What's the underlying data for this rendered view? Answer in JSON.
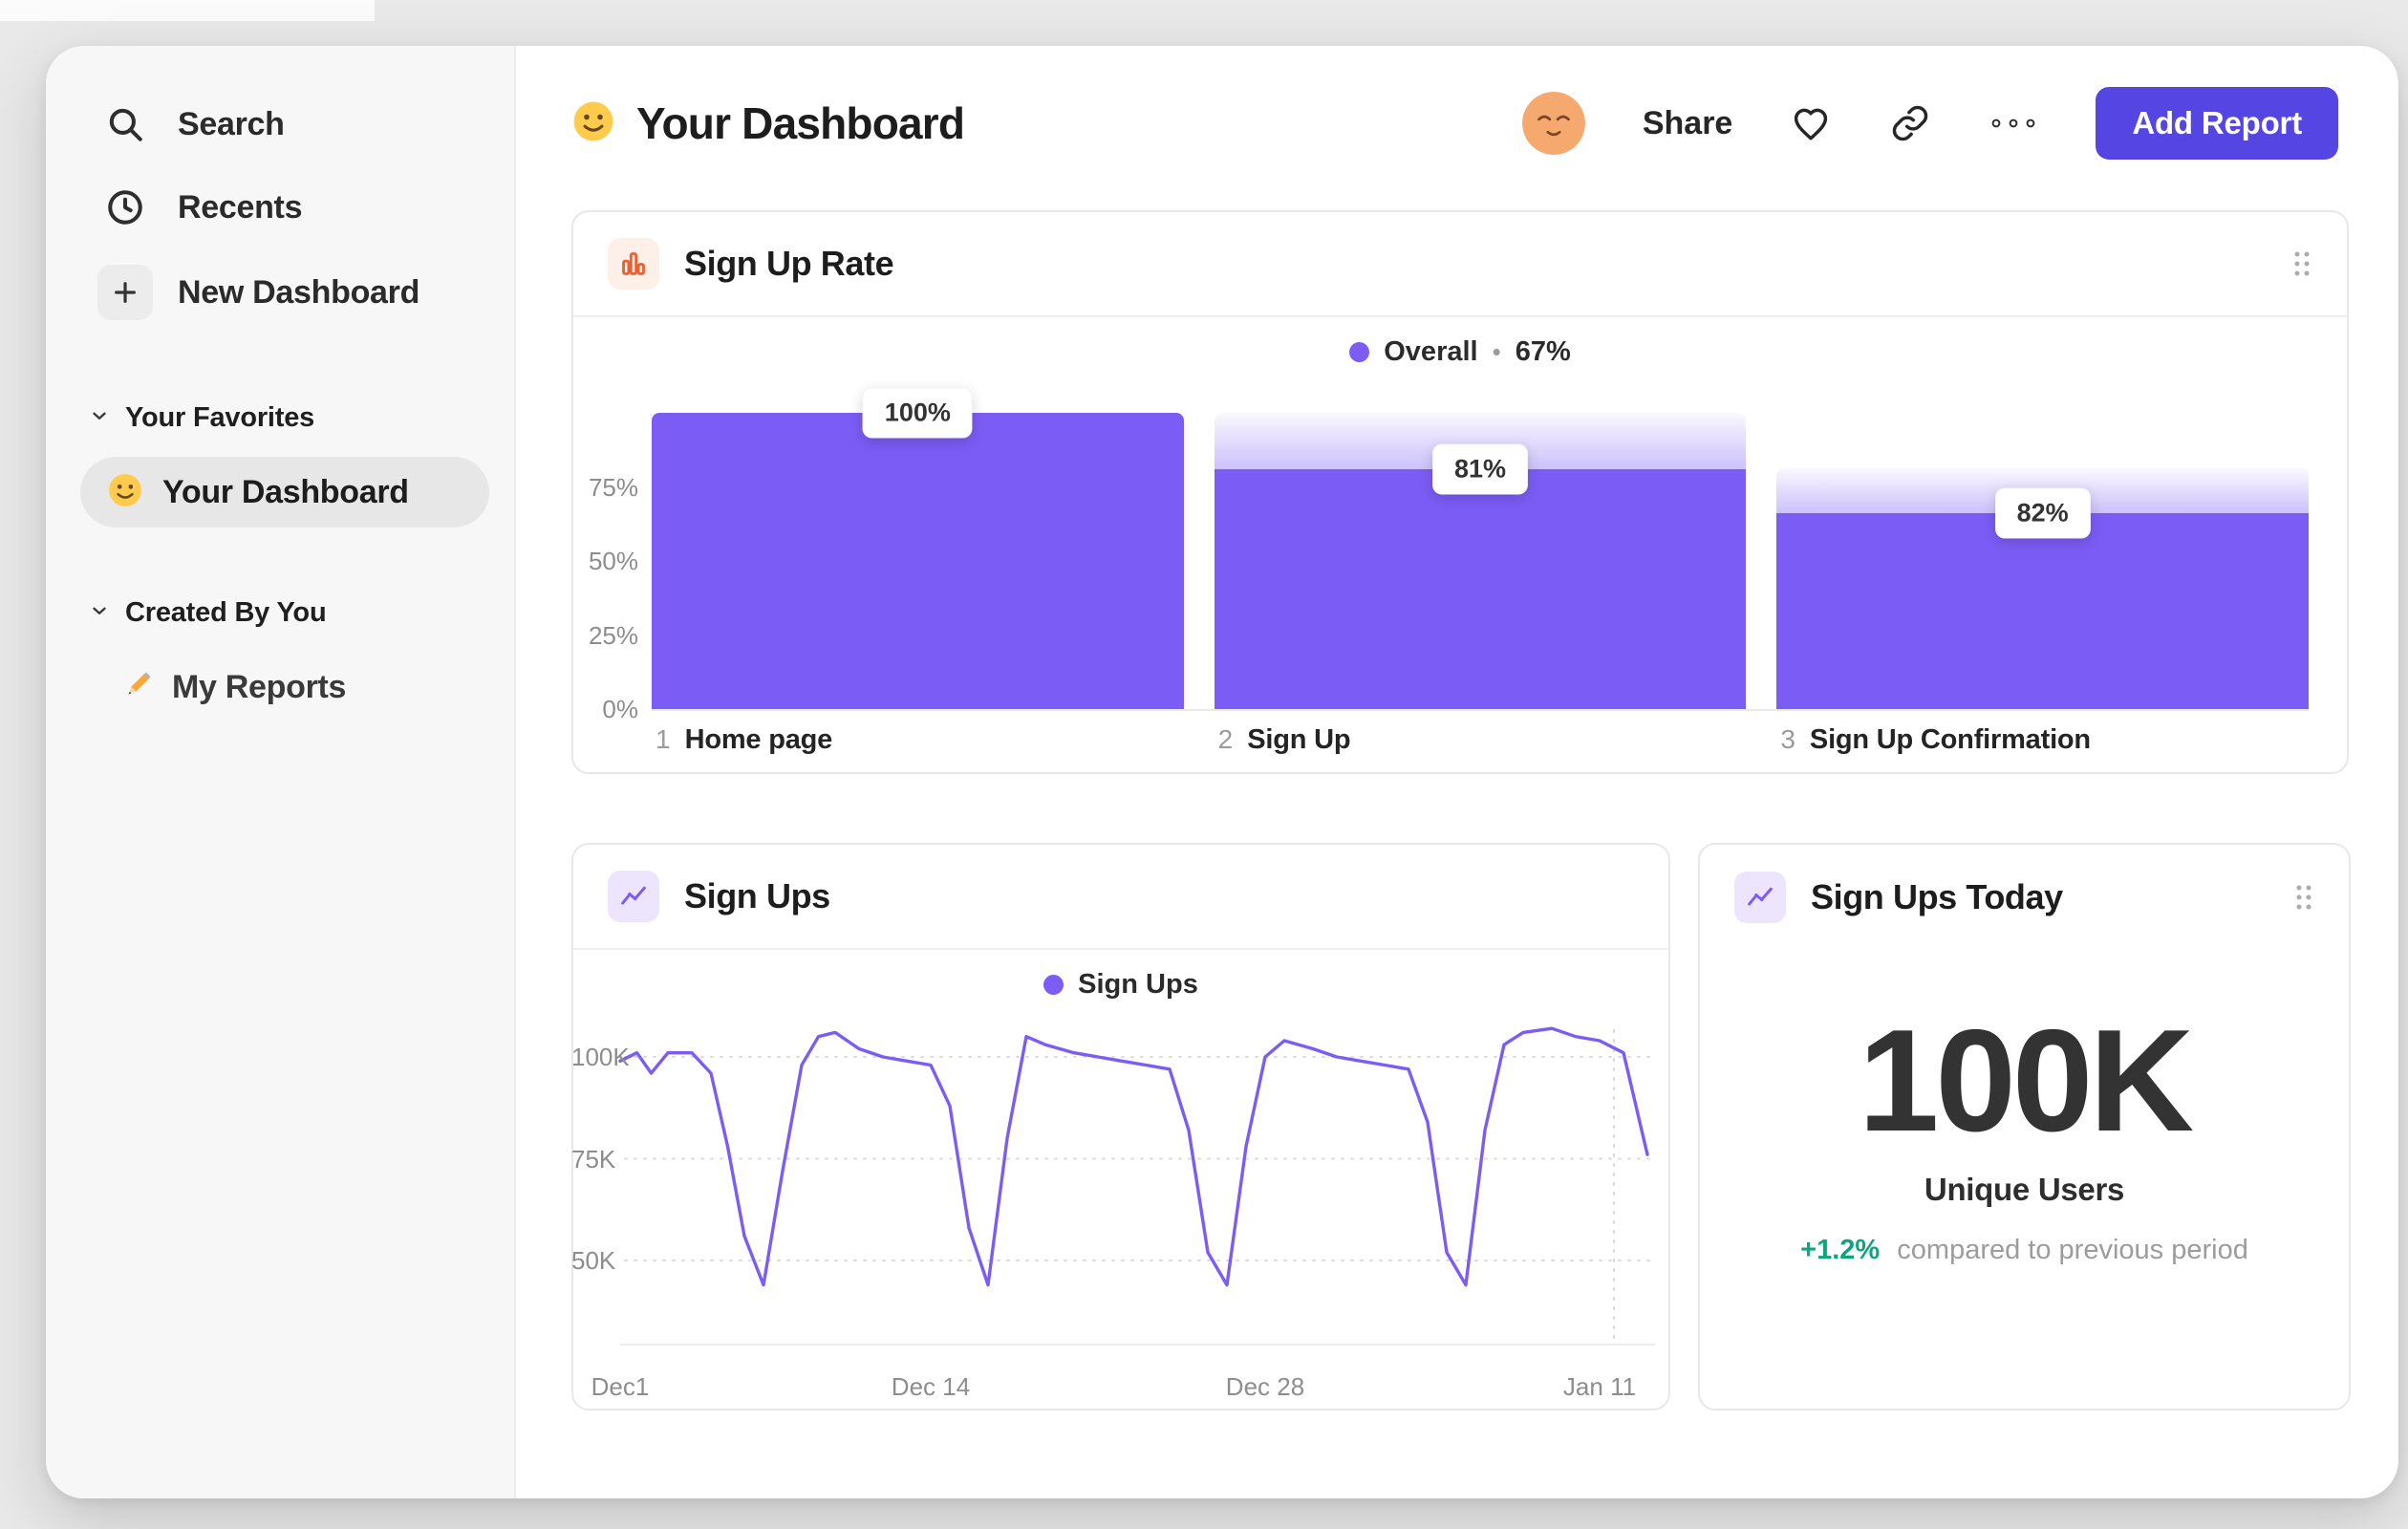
{
  "app": {
    "colors": {
      "accent_purple": "#7B5CF5",
      "button_purple": "#5546E4",
      "positive_green": "#0AA67E",
      "icon_orange": "#ED5F2F"
    }
  },
  "sidebar": {
    "search_label": "Search",
    "recents_label": "Recents",
    "new_dashboard_label": "New Dashboard",
    "favorites_section_title": "Your Favorites",
    "favorite_item_label": "Your Dashboard",
    "created_section_title": "Created By You",
    "created_item_label": "My Reports"
  },
  "header": {
    "title": "Your Dashboard",
    "share_label": "Share",
    "add_report_label": "Add Report"
  },
  "funnel_card": {
    "title": "Sign Up Rate",
    "legend_label": "Overall",
    "legend_separator": "•",
    "legend_value": "67%"
  },
  "line_card": {
    "title": "Sign Ups",
    "legend_label": "Sign Ups"
  },
  "today_card": {
    "title": "Sign Ups Today",
    "value": "100K",
    "label": "Unique Users",
    "delta": "+1.2%",
    "delta_note": "compared to previous period"
  },
  "chart_data": [
    {
      "type": "bar",
      "subtype": "funnel",
      "title": "Sign Up Rate",
      "legend": [
        {
          "label": "Overall",
          "value_pct": 67
        }
      ],
      "categories": [
        "Home page",
        "Sign Up",
        "Sign Up Confirmation"
      ],
      "steps": [
        {
          "num": "1",
          "name": "Home page",
          "rate_label": "100%",
          "step_conversion_pct": 100,
          "absolute_pct": 100,
          "cap_top_pct": 100
        },
        {
          "num": "2",
          "name": "Sign Up",
          "rate_label": "81%",
          "step_conversion_pct": 81,
          "absolute_pct": 81,
          "cap_top_pct": 100
        },
        {
          "num": "3",
          "name": "Sign Up Confirmation",
          "rate_label": "82%",
          "step_conversion_pct": 82,
          "absolute_pct": 66,
          "cap_top_pct": 81
        }
      ],
      "y_ticks": [
        {
          "label": "75%",
          "value": 75
        },
        {
          "label": "50%",
          "value": 50
        },
        {
          "label": "25%",
          "value": 25
        },
        {
          "label": "0%",
          "value": 0
        }
      ],
      "ylim": [
        0,
        100
      ],
      "legend_position": "top-center"
    },
    {
      "type": "line",
      "title": "Sign Ups",
      "series": [
        {
          "name": "Sign Ups",
          "points_day_valueK": [
            [
              0,
              99
            ],
            [
              0.7,
              101
            ],
            [
              1.3,
              96
            ],
            [
              2,
              101
            ],
            [
              3,
              101
            ],
            [
              3.8,
              96
            ],
            [
              4.5,
              78
            ],
            [
              5.2,
              56
            ],
            [
              6,
              44
            ],
            [
              6.8,
              72
            ],
            [
              7.6,
              98
            ],
            [
              8.3,
              105
            ],
            [
              9,
              106
            ],
            [
              10,
              102
            ],
            [
              11,
              100
            ],
            [
              12,
              99
            ],
            [
              13,
              98
            ],
            [
              13.8,
              88
            ],
            [
              14.6,
              58
            ],
            [
              15.4,
              44
            ],
            [
              16.2,
              80
            ],
            [
              17,
              105
            ],
            [
              17.8,
              103
            ],
            [
              19,
              101
            ],
            [
              20,
              100
            ],
            [
              21,
              99
            ],
            [
              22,
              98
            ],
            [
              23,
              97
            ],
            [
              23.8,
              82
            ],
            [
              24.6,
              52
            ],
            [
              25.4,
              44
            ],
            [
              26.2,
              78
            ],
            [
              27,
              100
            ],
            [
              27.8,
              104
            ],
            [
              29,
              102
            ],
            [
              30,
              100
            ],
            [
              31,
              99
            ],
            [
              32,
              98
            ],
            [
              33,
              97
            ],
            [
              33.8,
              84
            ],
            [
              34.6,
              52
            ],
            [
              35.4,
              44
            ],
            [
              36.2,
              82
            ],
            [
              37,
              103
            ],
            [
              37.8,
              106
            ],
            [
              39,
              107
            ],
            [
              40,
              105
            ],
            [
              41,
              104
            ],
            [
              42,
              101
            ],
            [
              43,
              76
            ]
          ]
        }
      ],
      "x_ticks": [
        {
          "label": "Dec1",
          "day": 0
        },
        {
          "label": "Dec 14",
          "day": 13
        },
        {
          "label": "Dec 28",
          "day": 27
        },
        {
          "label": "Jan 11",
          "day": 41
        }
      ],
      "y_ticks": [
        {
          "label": "100K",
          "value": 100
        },
        {
          "label": "75K",
          "value": 75
        },
        {
          "label": "50K",
          "value": 50
        }
      ],
      "ylim_k": [
        30,
        112
      ],
      "xlim_days": [
        0,
        43
      ],
      "now_marker_day": 41.6,
      "grid": "dotted-horizontal",
      "legend_position": "top-center"
    }
  ]
}
